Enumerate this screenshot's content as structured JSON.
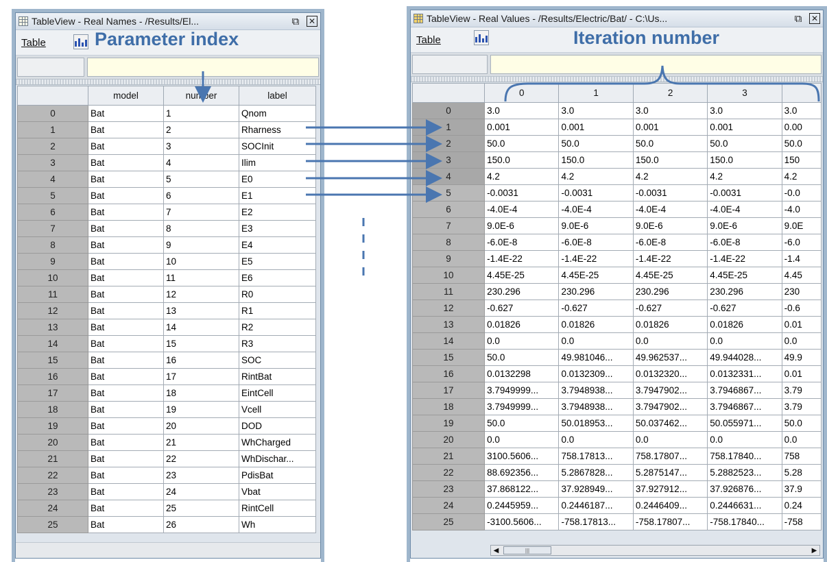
{
  "left_window": {
    "title": "TableView - Real Names - /Results/El...",
    "menu_table": "Table",
    "columns": [
      "model",
      "number",
      "label"
    ],
    "rows": [
      [
        "0",
        "Bat",
        "1",
        "Qnom"
      ],
      [
        "1",
        "Bat",
        "2",
        "Rharness"
      ],
      [
        "2",
        "Bat",
        "3",
        "SOCInit"
      ],
      [
        "3",
        "Bat",
        "4",
        "Ilim"
      ],
      [
        "4",
        "Bat",
        "5",
        "E0"
      ],
      [
        "5",
        "Bat",
        "6",
        "E1"
      ],
      [
        "6",
        "Bat",
        "7",
        "E2"
      ],
      [
        "7",
        "Bat",
        "8",
        "E3"
      ],
      [
        "8",
        "Bat",
        "9",
        "E4"
      ],
      [
        "9",
        "Bat",
        "10",
        "E5"
      ],
      [
        "10",
        "Bat",
        "11",
        "E6"
      ],
      [
        "11",
        "Bat",
        "12",
        "R0"
      ],
      [
        "12",
        "Bat",
        "13",
        "R1"
      ],
      [
        "13",
        "Bat",
        "14",
        "R2"
      ],
      [
        "14",
        "Bat",
        "15",
        "R3"
      ],
      [
        "15",
        "Bat",
        "16",
        "SOC"
      ],
      [
        "16",
        "Bat",
        "17",
        "RintBat"
      ],
      [
        "17",
        "Bat",
        "18",
        "EintCell"
      ],
      [
        "18",
        "Bat",
        "19",
        "Vcell"
      ],
      [
        "19",
        "Bat",
        "20",
        "DOD"
      ],
      [
        "20",
        "Bat",
        "21",
        "WhCharged"
      ],
      [
        "21",
        "Bat",
        "22",
        "WhDischar..."
      ],
      [
        "22",
        "Bat",
        "23",
        "PdisBat"
      ],
      [
        "23",
        "Bat",
        "24",
        "Vbat"
      ],
      [
        "24",
        "Bat",
        "25",
        "RintCell"
      ],
      [
        "25",
        "Bat",
        "26",
        "Wh"
      ]
    ]
  },
  "right_window": {
    "title": "TableView - Real Values - /Results/Electric/Bat/ - C:\\Us...",
    "menu_table": "Table",
    "columns": [
      "0",
      "1",
      "2",
      "3",
      ""
    ],
    "rows": [
      [
        "0",
        "3.0",
        "3.0",
        "3.0",
        "3.0",
        "3.0"
      ],
      [
        "1",
        "0.001",
        "0.001",
        "0.001",
        "0.001",
        "0.00"
      ],
      [
        "2",
        "50.0",
        "50.0",
        "50.0",
        "50.0",
        "50.0"
      ],
      [
        "3",
        "150.0",
        "150.0",
        "150.0",
        "150.0",
        "150"
      ],
      [
        "4",
        "4.2",
        "4.2",
        "4.2",
        "4.2",
        "4.2"
      ],
      [
        "5",
        "-0.0031",
        "-0.0031",
        "-0.0031",
        "-0.0031",
        "-0.0"
      ],
      [
        "6",
        "-4.0E-4",
        "-4.0E-4",
        "-4.0E-4",
        "-4.0E-4",
        "-4.0"
      ],
      [
        "7",
        "9.0E-6",
        "9.0E-6",
        "9.0E-6",
        "9.0E-6",
        "9.0E"
      ],
      [
        "8",
        "-6.0E-8",
        "-6.0E-8",
        "-6.0E-8",
        "-6.0E-8",
        "-6.0"
      ],
      [
        "9",
        "-1.4E-22",
        "-1.4E-22",
        "-1.4E-22",
        "-1.4E-22",
        "-1.4"
      ],
      [
        "10",
        "4.45E-25",
        "4.45E-25",
        "4.45E-25",
        "4.45E-25",
        "4.45"
      ],
      [
        "11",
        "230.296",
        "230.296",
        "230.296",
        "230.296",
        "230"
      ],
      [
        "12",
        "-0.627",
        "-0.627",
        "-0.627",
        "-0.627",
        "-0.6"
      ],
      [
        "13",
        "0.01826",
        "0.01826",
        "0.01826",
        "0.01826",
        "0.01"
      ],
      [
        "14",
        "0.0",
        "0.0",
        "0.0",
        "0.0",
        "0.0"
      ],
      [
        "15",
        "50.0",
        "49.981046...",
        "49.962537...",
        "49.944028...",
        "49.9"
      ],
      [
        "16",
        "0.0132298",
        "0.0132309...",
        "0.0132320...",
        "0.0132331...",
        "0.01"
      ],
      [
        "17",
        "3.7949999...",
        "3.7948938...",
        "3.7947902...",
        "3.7946867...",
        "3.79"
      ],
      [
        "18",
        "3.7949999...",
        "3.7948938...",
        "3.7947902...",
        "3.7946867...",
        "3.79"
      ],
      [
        "19",
        "50.0",
        "50.018953...",
        "50.037462...",
        "50.055971...",
        "50.0"
      ],
      [
        "20",
        "0.0",
        "0.0",
        "0.0",
        "0.0",
        "0.0"
      ],
      [
        "21",
        "3100.5606...",
        "758.17813...",
        "758.17807...",
        "758.17840...",
        "758"
      ],
      [
        "22",
        "88.692356...",
        "5.2867828...",
        "5.2875147...",
        "5.2882523...",
        "5.28"
      ],
      [
        "23",
        "37.868122...",
        "37.928949...",
        "37.927912...",
        "37.926876...",
        "37.9"
      ],
      [
        "24",
        "0.2445959...",
        "0.2446187...",
        "0.2446409...",
        "0.2446631...",
        "0.24"
      ],
      [
        "25",
        "-3100.5606...",
        "-758.17813...",
        "-758.17807...",
        "-758.17840...",
        "-758"
      ]
    ]
  },
  "annotations": {
    "parameter_index": "Parameter index",
    "iteration_number": "Iteration number"
  },
  "icons": {
    "table_icon": "grid-icon",
    "chart_button": "bar-chart-icon",
    "undock": "undock-icon",
    "close": "close-icon"
  },
  "colors": {
    "annotation": "#3f6ea8",
    "arrow": "#4a76b0",
    "row_header": "#b9b9b9"
  }
}
